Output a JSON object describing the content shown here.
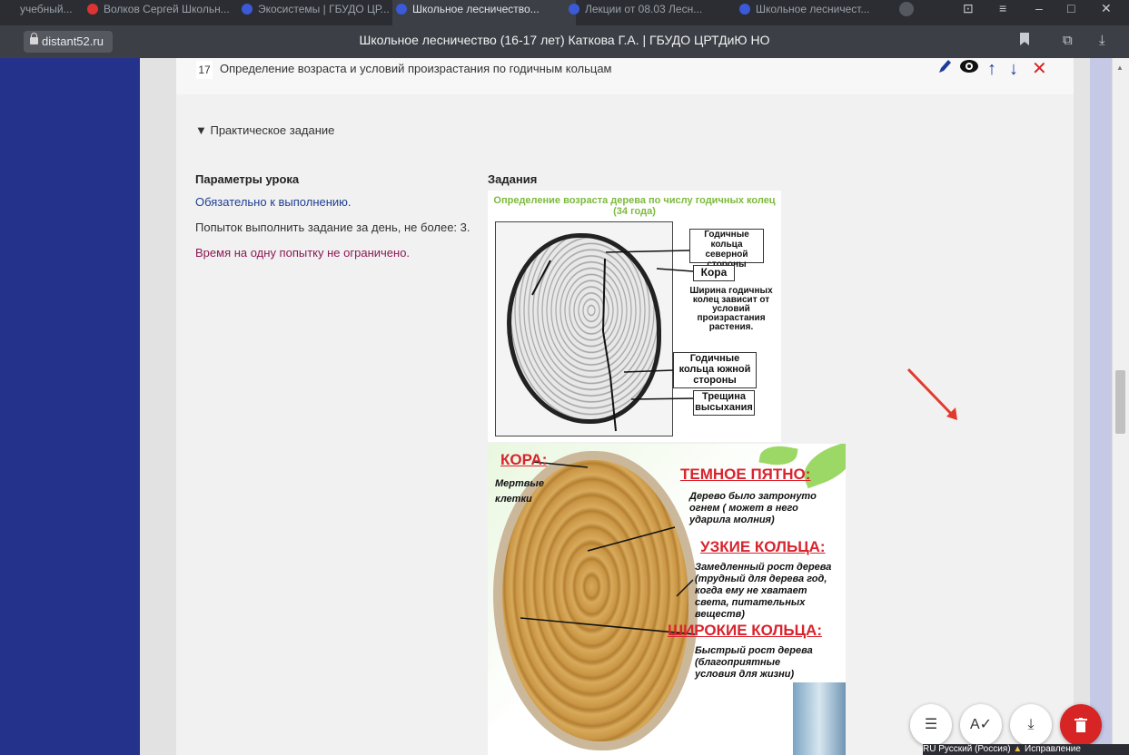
{
  "browser": {
    "tabs": [
      {
        "label": "учебный...",
        "active": false
      },
      {
        "label": "Волков Сергей Школьн...",
        "active": false
      },
      {
        "label": "Экосистемы | ГБУДО ЦР...",
        "active": false
      },
      {
        "label": "Школьное лесничество...",
        "active": true
      },
      {
        "label": "Лекции от 08.03 Лесн...",
        "active": false
      },
      {
        "label": "Школьное лесничест...",
        "active": false
      }
    ],
    "domain": "distant52.ru",
    "page_title": "Школьное лесничество (16-17 лет) Каткова Г.А. | ГБУДО ЦРТДиЮ НО"
  },
  "lesson": {
    "number": "17",
    "title": "Определение возраста и условий произрастания по годичным кольцам"
  },
  "section": {
    "toggle": "▼ Практическое задание"
  },
  "params": {
    "heading": "Параметры урока",
    "required": "Обязательно к выполнению.",
    "attempts": "Попыток выполнить задание за день, не более: 3.",
    "time": "Время на одну попытку не ограничено."
  },
  "tasks": {
    "heading": "Задания"
  },
  "image1": {
    "caption_line1": "Определение возраста дерева по числу годичных колец",
    "caption_line2": "(34 года)",
    "label_north": "Годичные кольца северной стороны",
    "label_bark": "Кора",
    "label_width": "Ширина годичных колец зависит от условий произрастания растения.",
    "label_south": "Годичные кольца южной стороны",
    "label_crack": "Трещина высыхания"
  },
  "image2": {
    "bark_head": "КОРА:",
    "bark_text": "Мертвые клетки",
    "dark_head": "ТЕМНОЕ ПЯТНО:",
    "dark_text": "Дерево было затронуто огнем ( может в него ударила молния)",
    "narrow_head": "УЗКИЕ КОЛЬЦА:",
    "narrow_text": "Замедленный рост дерева (трудный для дерева год, когда ему не хватает света, питательных веществ)",
    "wide_head": "ШИРОКИЕ КОЛЬЦА:",
    "wide_text": "Быстрый рост дерева (благоприятные условия для жизни)"
  },
  "taskbar": {
    "lang": "RU Русский (Россия)",
    "status": "Исправление"
  },
  "colors": {
    "sidebar": "#24328c",
    "accent_red": "#d72424",
    "link_blue": "#1f3f94",
    "notice_purple": "#8b1a55"
  },
  "icons": [
    "lock-icon",
    "bookmark-icon",
    "extension-icon",
    "download-icon",
    "edit-icon",
    "eye-icon",
    "arrow-up-icon",
    "arrow-down-icon",
    "close-icon",
    "list-icon",
    "spellcheck-icon",
    "download-fab-icon",
    "trash-icon"
  ]
}
